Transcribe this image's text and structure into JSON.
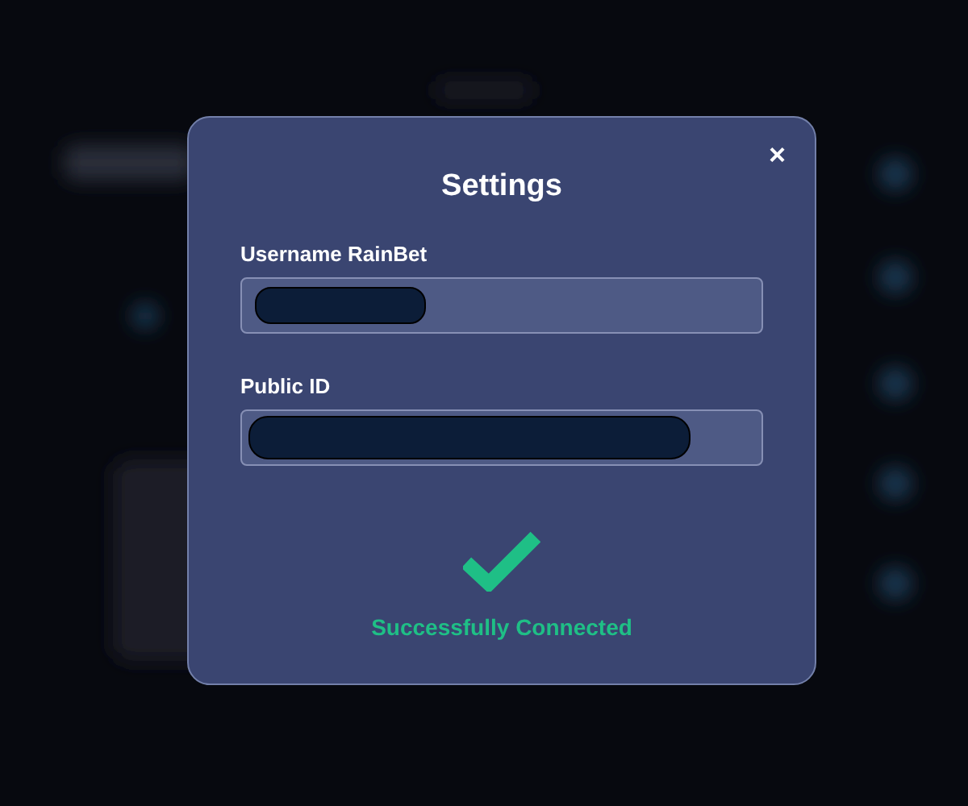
{
  "dialog": {
    "title": "Settings",
    "close": "×",
    "fields": [
      {
        "label": "Username RainBet",
        "redacted": true
      },
      {
        "label": "Public ID",
        "redacted": true
      }
    ],
    "status": {
      "kind": "success",
      "message": "Successfully Connected"
    }
  }
}
